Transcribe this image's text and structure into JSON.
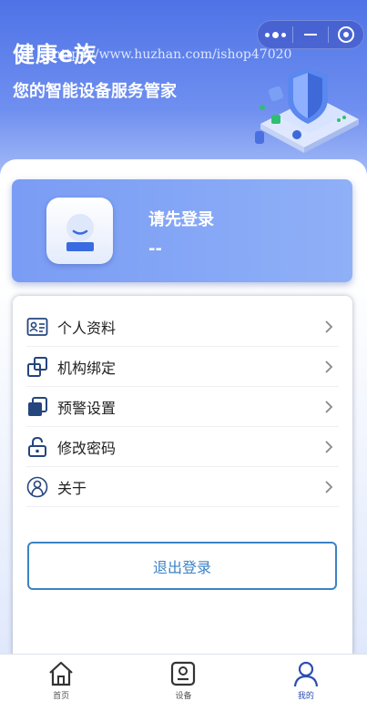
{
  "header": {
    "app_title": "健康e族",
    "subtitle": "您的智能设备服务管家",
    "watermark": "https://www.huzhan.com/ishop47020"
  },
  "capsule": {
    "more_icon": "dots-icon",
    "minimize_icon": "minus-icon",
    "close_icon": "target-icon"
  },
  "profile": {
    "login_prompt": "请先登录",
    "account": "--"
  },
  "menu": {
    "items": [
      {
        "label": "个人资料",
        "icon": "id-card-icon"
      },
      {
        "label": "机构绑定",
        "icon": "link-squares-icon"
      },
      {
        "label": "预警设置",
        "icon": "stacked-squares-icon"
      },
      {
        "label": "修改密码",
        "icon": "lock-icon"
      },
      {
        "label": "关于",
        "icon": "user-outline-icon"
      }
    ],
    "logout_label": "退出登录"
  },
  "tabbar": {
    "tabs": [
      {
        "label": "首页",
        "icon": "home-icon",
        "active": false
      },
      {
        "label": "设备",
        "icon": "device-icon",
        "active": false
      },
      {
        "label": "我的",
        "icon": "person-icon",
        "active": true
      }
    ]
  },
  "colors": {
    "header_blue": "#4e73e6",
    "accent_blue": "#3b83c4",
    "active_tab": "#2a4fb0",
    "icon_navy": "#24457e"
  }
}
